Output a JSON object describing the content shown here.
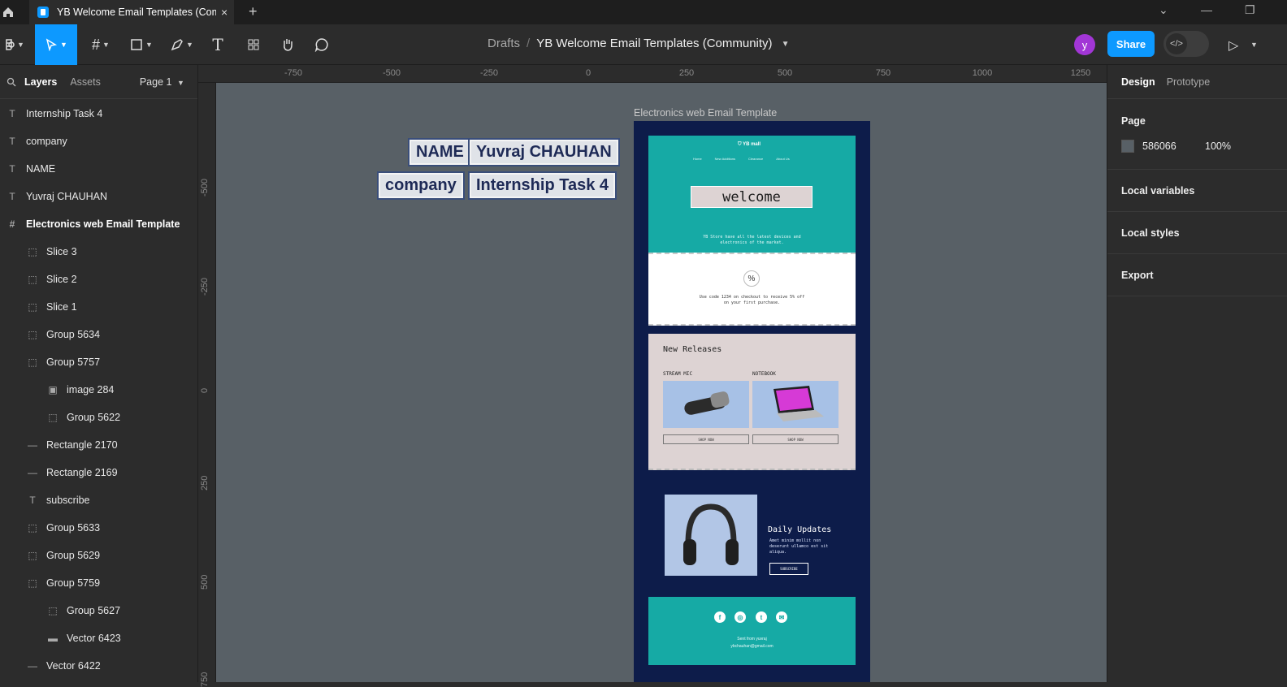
{
  "titlebar": {
    "tab_title": "YB Welcome Email Templates (Community)",
    "close_glyph": "×",
    "new_tab_glyph": "+",
    "dropdown_glyph": "⌄",
    "minimize_glyph": "—",
    "restore_glyph": "❐"
  },
  "toolbar": {
    "breadcrumb_drafts": "Drafts",
    "breadcrumb_sep": "/",
    "breadcrumb_file": "YB Welcome Email Templates (Community)",
    "avatar_letter": "y",
    "share_label": "Share",
    "devmode_glyph": "</>",
    "present_glyph": "▷"
  },
  "left_panel": {
    "tab_layers": "Layers",
    "tab_assets": "Assets",
    "page_selector": "Page 1",
    "layers": [
      {
        "label": "Internship Task 4",
        "icon": "text-icon",
        "indent": 0
      },
      {
        "label": "company",
        "icon": "text-icon",
        "indent": 0
      },
      {
        "label": "NAME",
        "icon": "text-icon",
        "indent": 0
      },
      {
        "label": "Yuvraj CHAUHAN",
        "icon": "text-icon",
        "indent": 0
      },
      {
        "label": "Electronics web Email Template",
        "icon": "frame-icon",
        "indent": 0
      },
      {
        "label": "Slice 3",
        "icon": "slice-icon",
        "indent": 1
      },
      {
        "label": "Slice 2",
        "icon": "slice-icon",
        "indent": 1
      },
      {
        "label": "Slice 1",
        "icon": "slice-icon",
        "indent": 1
      },
      {
        "label": "Group 5634",
        "icon": "group-icon",
        "indent": 1
      },
      {
        "label": "Group 5757",
        "icon": "group-icon",
        "indent": 1
      },
      {
        "label": "image 284",
        "icon": "image-icon",
        "indent": 2
      },
      {
        "label": "Group 5622",
        "icon": "group-icon",
        "indent": 2
      },
      {
        "label": "Rectangle 2170",
        "icon": "line-icon",
        "indent": 1
      },
      {
        "label": "Rectangle 2169",
        "icon": "line-icon",
        "indent": 1
      },
      {
        "label": "subscribe",
        "icon": "text-icon",
        "indent": 1
      },
      {
        "label": "Group 5633",
        "icon": "group-icon",
        "indent": 1
      },
      {
        "label": "Group 5629",
        "icon": "group-icon",
        "indent": 1
      },
      {
        "label": "Group 5759",
        "icon": "group-icon",
        "indent": 1
      },
      {
        "label": "Group 5627",
        "icon": "group-icon",
        "indent": 2
      },
      {
        "label": "Vector 6423",
        "icon": "vector-icon",
        "indent": 2
      },
      {
        "label": "Vector 6422",
        "icon": "line-icon",
        "indent": 1
      }
    ]
  },
  "rulers": {
    "x_ticks": [
      "-750",
      "-500",
      "-250",
      "0",
      "250",
      "500",
      "750",
      "1000",
      "1250"
    ],
    "y_ticks": [
      "-500",
      "-250",
      "0",
      "250",
      "500",
      "750"
    ]
  },
  "canvas": {
    "background": "#586066",
    "stickers": {
      "name": "NAME",
      "person": "Yuvraj CHAUHAN",
      "company": "company",
      "task": "Internship Task 4"
    },
    "frame_label": "Electronics web Email Template",
    "email": {
      "logo": "YB mall",
      "nav": [
        "Home",
        "New Additions",
        "Clearance",
        "About Us"
      ],
      "welcome": "welcome",
      "hero_sub": "YB Store have all the latest devices and electronics of the market.",
      "promo_icon": "%",
      "promo_text": "Use code 1234 on checkout to receive 5% off on your first purchase.",
      "releases_title": "New Releases",
      "product1": "STREAM MIC",
      "product2": "NOTEBOOK",
      "shop_now": "SHOP NOW",
      "daily_title": "Daily Updates",
      "daily_body": "Amet minim mollit non deserunt ullamco est sit aliqua.",
      "subscribe": "SUBSCRIBE",
      "social": [
        "f",
        "◎",
        "t",
        "✉"
      ],
      "footer_line1": "Sent from yuvraj",
      "footer_line2": "ybchauhan@gmail.com"
    }
  },
  "right_panel": {
    "tab_design": "Design",
    "tab_prototype": "Prototype",
    "page_title": "Page",
    "page_color": "586066",
    "page_opacity": "100%",
    "local_variables": "Local variables",
    "local_styles": "Local styles",
    "export": "Export"
  }
}
